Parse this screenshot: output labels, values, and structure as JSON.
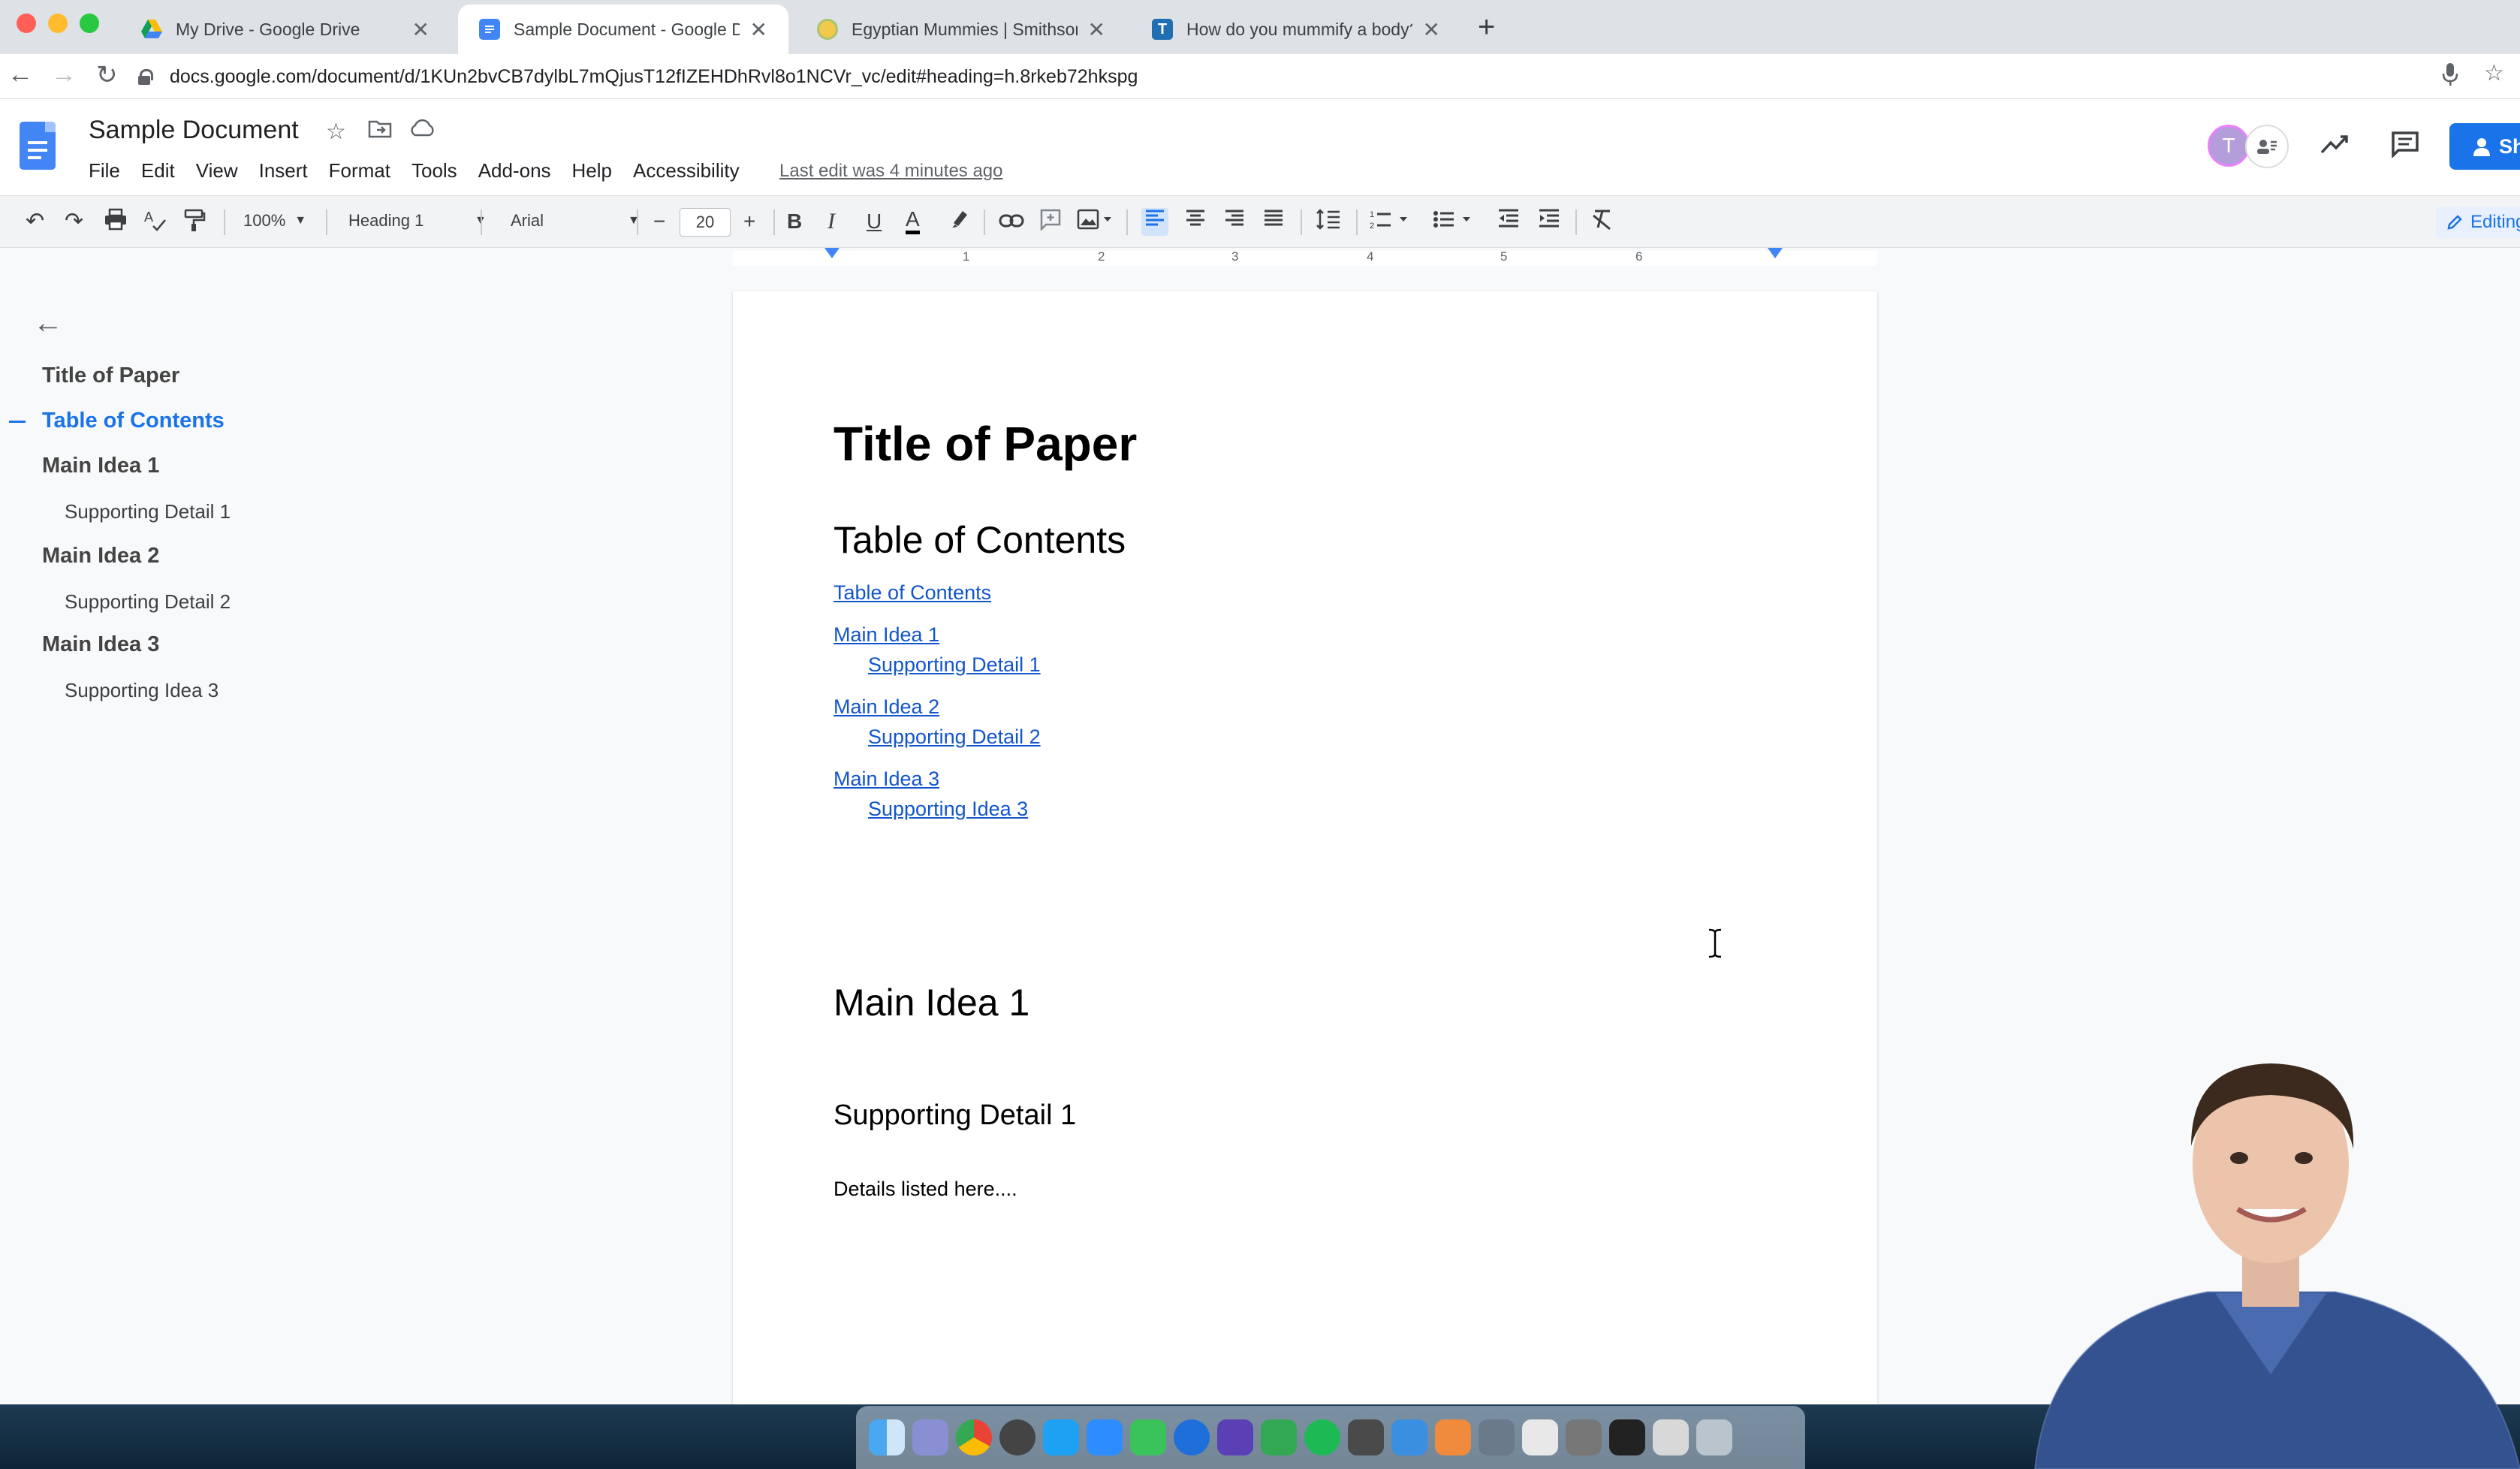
{
  "browser": {
    "tabs": [
      {
        "label": "My Drive - Google Drive"
      },
      {
        "label": "Sample Document - Google Docs"
      },
      {
        "label": "Egyptian Mummies | Smithsonian"
      },
      {
        "label": "How do you mummify a body?"
      }
    ],
    "url": "docs.google.com/document/d/1KUn2bvCB7dylbL7mQjusT12fIZEHDhRvl8o1NCVr_vc/edit#heading=h.8rkeb72hkspg"
  },
  "docs": {
    "title": "Sample Document",
    "menu": [
      "File",
      "Edit",
      "View",
      "Insert",
      "Format",
      "Tools",
      "Add-ons",
      "Help",
      "Accessibility"
    ],
    "last_edit": "Last edit was 4 minutes ago",
    "avatar_initial": "T",
    "share_label": "Sh",
    "editing_label": "Editing"
  },
  "toolbar": {
    "zoom": "100%",
    "style": "Heading 1",
    "font": "Arial",
    "font_size": "20",
    "bold": "B",
    "italic": "I",
    "underline": "U",
    "text_color": "A"
  },
  "ruler": {
    "numbers": [
      "1",
      "2",
      "3",
      "4",
      "5",
      "6"
    ]
  },
  "outline": [
    {
      "label": "Title of Paper"
    },
    {
      "label": "Table of Contents"
    },
    {
      "label": "Main Idea 1"
    },
    {
      "label": "Supporting Detail 1"
    },
    {
      "label": "Main Idea 2"
    },
    {
      "label": "Supporting Detail 2"
    },
    {
      "label": "Main Idea 3"
    },
    {
      "label": "Supporting Idea 3"
    }
  ],
  "document": {
    "title": "Title of Paper",
    "toc_heading": "Table of Contents",
    "toc_links": [
      {
        "label": "Table of Contents"
      },
      {
        "label": "Main Idea 1"
      },
      {
        "label": "Supporting Detail 1"
      },
      {
        "label": "Main Idea 2"
      },
      {
        "label": "Supporting Detail 2"
      },
      {
        "label": "Main Idea 3"
      },
      {
        "label": "Supporting Idea 3"
      }
    ],
    "heading1": "Main Idea 1",
    "heading2": "Supporting Detail 1",
    "body_text": "Details listed here...."
  },
  "colors": {
    "accent": "#1a73e8",
    "link": "#1155cc",
    "docs_blue": "#4285f4"
  }
}
